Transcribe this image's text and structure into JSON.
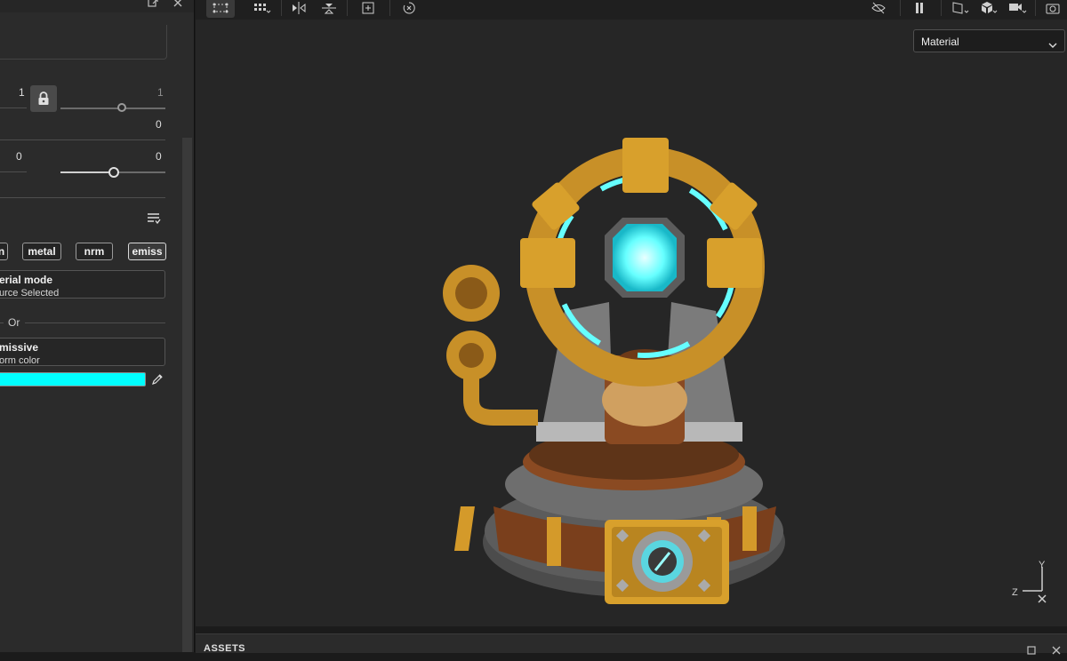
{
  "properties": {
    "lock_row": {
      "left_value": "1",
      "right_value": "1",
      "below_value": "0"
    },
    "offset_row": {
      "left_value": "0",
      "right_value": "0"
    },
    "channel_buttons": [
      "n",
      "metal",
      "nrm",
      "emiss"
    ],
    "material_mode": {
      "title": "erial mode",
      "value": "urce Selected"
    },
    "or_label": "Or",
    "emissive": {
      "title": "missive",
      "value": "orm color",
      "color": "#00ffff"
    }
  },
  "viewport": {
    "display_mode": "Material",
    "axis_labels": {
      "y": "Y",
      "z": "Z"
    }
  },
  "assets": {
    "title": "ASSETS"
  },
  "colors": {
    "panel_bg": "#2b2b2b",
    "viewport_bg": "#262626",
    "emissive": "#00ffff",
    "accent_gold": "#c8902a"
  }
}
